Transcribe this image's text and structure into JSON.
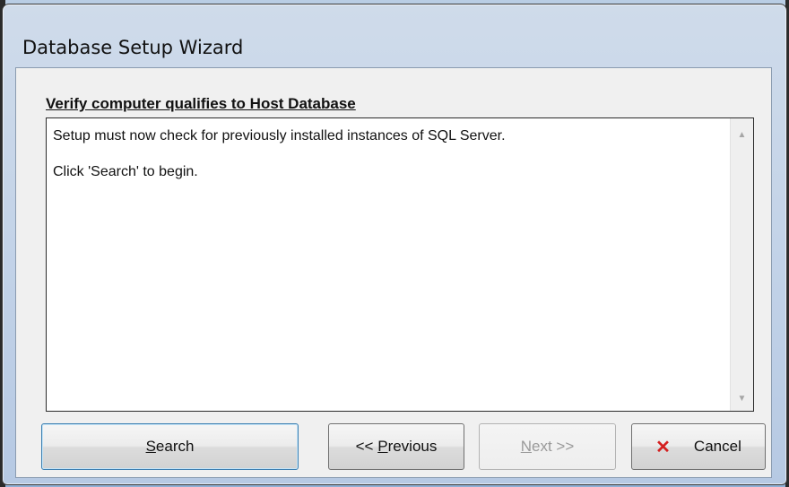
{
  "window": {
    "title": "Database Setup Wizard"
  },
  "section": {
    "heading": "Verify computer qualifies to Host Database"
  },
  "message": {
    "line1": "Setup must now check for previously installed instances of SQL Server.",
    "line2": "Click 'Search' to begin."
  },
  "buttons": {
    "search": {
      "mnemonic": "S",
      "rest": "earch"
    },
    "previous": {
      "prefix": "<< ",
      "mnemonic": "P",
      "rest": "revious"
    },
    "next": {
      "mnemonic": "N",
      "rest": "ext >>"
    },
    "cancel": {
      "label": "Cancel",
      "icon": "x-icon"
    }
  },
  "colors": {
    "cancel_icon": "#d42020",
    "focus_border": "#3c7fb1"
  }
}
